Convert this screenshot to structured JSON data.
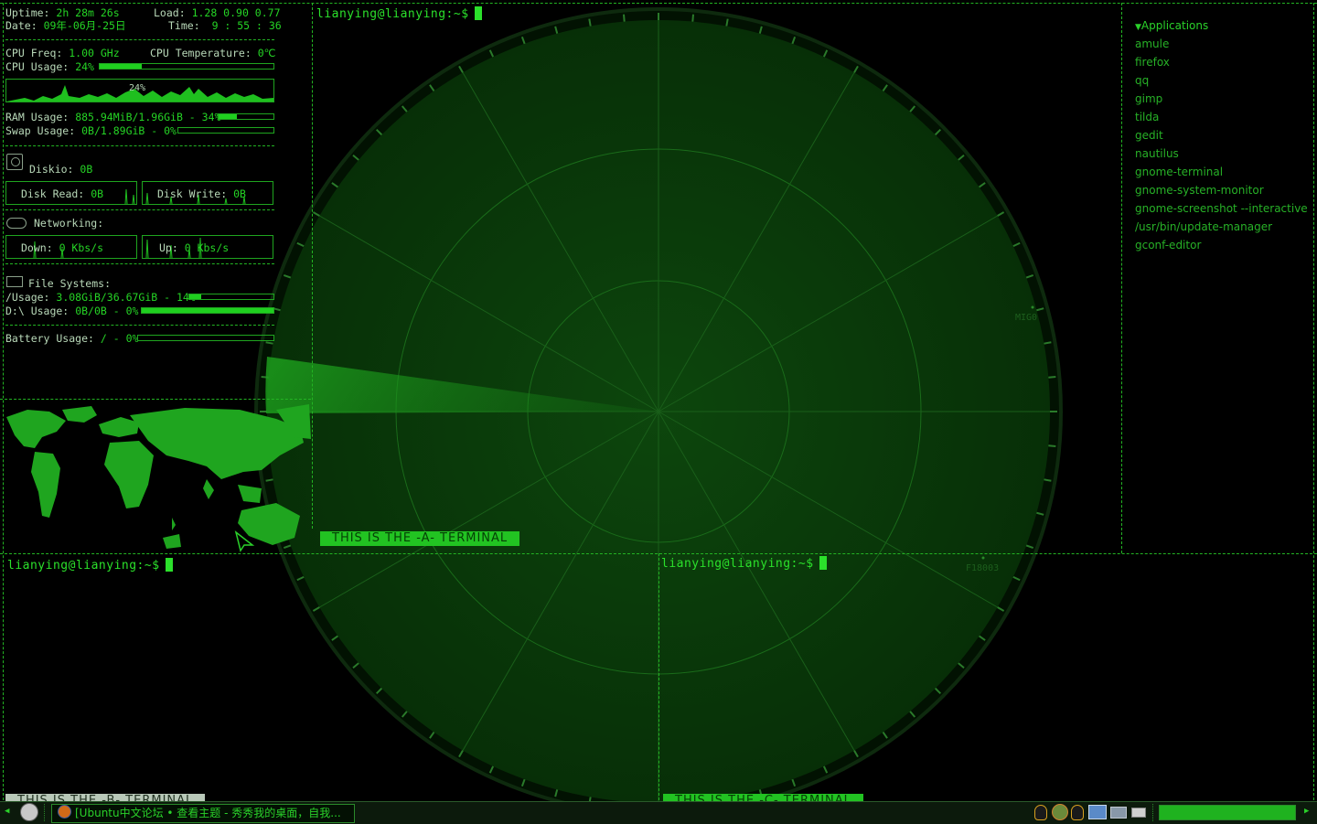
{
  "conky": {
    "uptime_label": "Uptime:",
    "uptime_value": "2h 28m 26s",
    "load_label": "Load:",
    "load_value": "1.28 0.90 0.77",
    "date_label": "Date:",
    "date_value": "09年-06月-25日",
    "time_label": "Time:",
    "time_value": "9 : 55 : 36",
    "cpu_freq_label": "CPU Freq:",
    "cpu_freq_value": "1.00 GHz",
    "cpu_temp_label": "CPU Temperature:",
    "cpu_temp_value": "0℃",
    "cpu_usage_label": "CPU Usage:",
    "cpu_usage_value": "24%",
    "cpu_usage_fraction": 0.24,
    "cpu_graph_label": "24%",
    "ram_label": "RAM Usage:",
    "ram_value": "885.94MiB/1.96GiB - 34%",
    "ram_fraction": 0.34,
    "swap_label": "Swap Usage:",
    "swap_value": "0B/1.89GiB - 0%",
    "swap_fraction": 0,
    "diskio_label": "Diskio:",
    "diskio_value": "0B",
    "disk_read_label": "Disk Read:",
    "disk_read_value": "0B",
    "disk_write_label": "Disk Write:",
    "disk_write_value": "0B",
    "networking_label": "Networking:",
    "down_label": "Down:",
    "down_value": "0 Kbs/s",
    "up_label": "Up:",
    "up_value": "0 Kbs/s",
    "fs_label": "File Systems:",
    "root_label": "/Usage:",
    "root_value": "3.08GiB/36.67GiB - 14%",
    "root_fraction": 0.14,
    "d_label": "D:\\ Usage:",
    "d_value": "0B/0B - 0%",
    "d_fraction": 1.0,
    "battery_label": "Battery Usage:",
    "battery_value": "/ - 0%",
    "battery_fraction": 0
  },
  "terminals": {
    "top_prompt": "lianying@lianying:~$",
    "bottom_left_prompt": "lianying@lianying:~$",
    "bottom_right_prompt": "lianying@lianying:~$",
    "banner_a": "THIS IS THE -A- TERMINAL",
    "banner_b": "THIS IS THE -B- TERMINAL",
    "banner_c": "THIS IS THE -C- TERMINAL"
  },
  "radar": {
    "label_1": "MIG0",
    "label_2": "F18003"
  },
  "menu": {
    "title": "Applications",
    "items": [
      "amule",
      "firefox",
      "qq",
      "gimp",
      "tilda",
      "gedit",
      "nautilus",
      "gnome-terminal",
      "gnome-system-monitor",
      "gnome-screenshot --interactive",
      "/usr/bin/update-manager",
      "gconf-editor"
    ]
  },
  "taskbar": {
    "task_title": "[Ubuntu中文论坛 • 查看主题 - 秀秀我的桌面，自我...",
    "meter_fraction": 1.0
  },
  "colors": {
    "accent": "#22c322",
    "radar": "#0a3a0a",
    "background": "#000000"
  }
}
